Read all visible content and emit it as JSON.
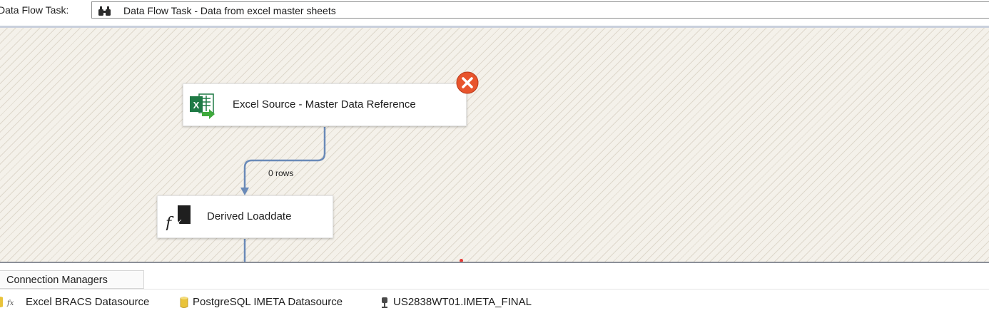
{
  "toolbar": {
    "label": "Data Flow Task:",
    "selected_task": "Data Flow Task - Data from excel master sheets"
  },
  "canvas": {
    "components": [
      {
        "name": "Excel Source - Master Data Reference",
        "icon": "excel-source-icon",
        "has_error": true
      },
      {
        "name": "Derived Loaddate",
        "icon": "derived-column-icon"
      }
    ],
    "paths": [
      {
        "label": "0 rows"
      }
    ]
  },
  "connection_managers": {
    "tab_label": "Connection Managers",
    "items": [
      {
        "label": "Excel BRACS Datasource",
        "icon": "excel-connection-fx-icon"
      },
      {
        "label": "PostgreSQL IMETA Datasource",
        "icon": "database-connection-icon"
      },
      {
        "label": "US2838WT01.IMETA_FINAL",
        "icon": "oledb-connection-icon"
      }
    ]
  },
  "colors": {
    "error": "#e8542c",
    "path_line": "#6a8ab8",
    "canvas_bg": "#f4f1ea",
    "excel_green": "#1f7a45"
  }
}
